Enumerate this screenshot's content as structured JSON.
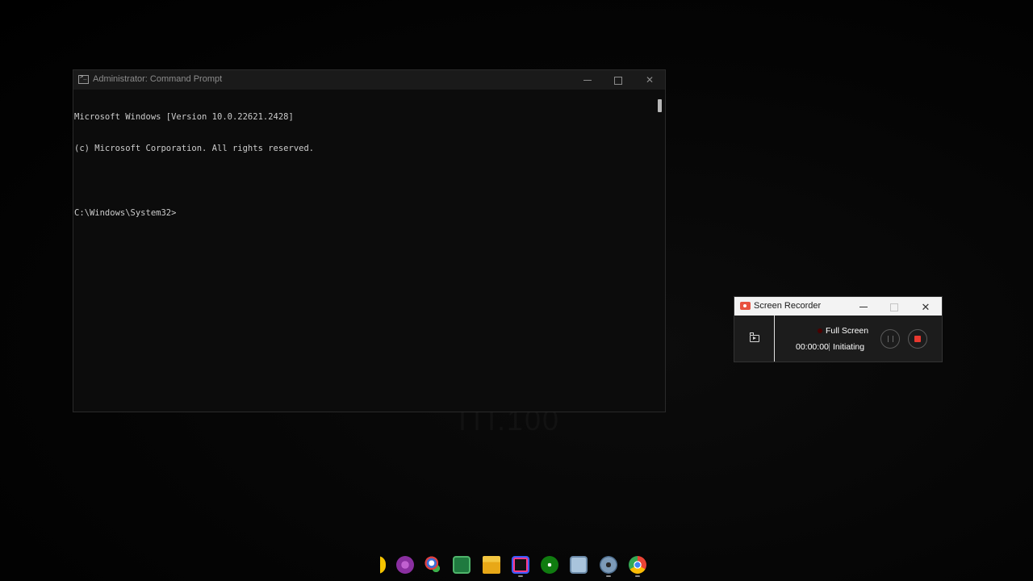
{
  "cmd": {
    "title": "Administrator: Command Prompt",
    "lines": [
      "Microsoft Windows [Version 10.0.22621.2428]",
      "(c) Microsoft Corporation. All rights reserved.",
      "",
      "C:\\Windows\\System32>"
    ]
  },
  "recorder": {
    "title": "Screen Recorder",
    "mode": "Full Screen",
    "timer": "00:00:00",
    "state": "Initiating",
    "accent_color": "#e8382f"
  },
  "wallpaper": {
    "text": "ITI.100"
  },
  "taskbar": {
    "icons": [
      {
        "name": "partial-app-icon"
      },
      {
        "name": "purple-app-icon"
      },
      {
        "name": "paint-app-icon"
      },
      {
        "name": "spreadsheet-app-icon"
      },
      {
        "name": "file-explorer-icon"
      },
      {
        "name": "intellij-idea-icon"
      },
      {
        "name": "xbox-icon"
      },
      {
        "name": "snipping-tool-icon"
      },
      {
        "name": "settings-icon"
      },
      {
        "name": "chrome-icon"
      }
    ]
  }
}
